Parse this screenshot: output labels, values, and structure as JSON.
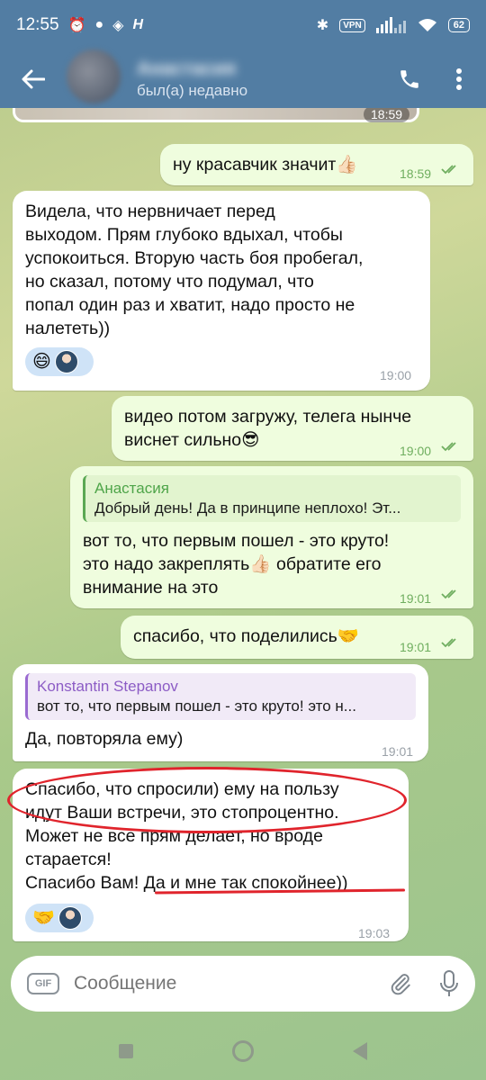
{
  "status_bar": {
    "time": "12:55",
    "vpn": "VPN",
    "battery": "62"
  },
  "header": {
    "contact_name": "Анастасия",
    "contact_status": "был(а) недавно"
  },
  "photo_time": "18:59",
  "messages": [
    {
      "id": "m1",
      "side": "out",
      "text": "ну красавчик значит👍🏻",
      "time": "18:59"
    },
    {
      "id": "m2",
      "side": "in",
      "lines": [
        "Видела, что нервничает перед",
        "выходом. Прям глубоко вдыхал, чтобы",
        "успокоиться. Вторую часть боя пробегал,",
        "но сказал, потому что подумал, что",
        "попал один раз и хватит, надо просто не",
        "налететь))"
      ],
      "time": "19:00",
      "reaction": "😄"
    },
    {
      "id": "m3",
      "side": "out",
      "lines": [
        "видео потом загружу, телега нынче",
        "виснет сильно😎"
      ],
      "time": "19:00"
    },
    {
      "id": "m4",
      "side": "out",
      "reply_name": "Анастасия",
      "reply_text": "Добрый день! Да в принципе неплохо! Эт...",
      "lines": [
        "вот то, что первым пошел - это круто!",
        "это надо закреплять👍🏻 обратите его",
        "внимание на это"
      ],
      "time": "19:01"
    },
    {
      "id": "m5",
      "side": "out",
      "text": "спасибо, что поделились🤝",
      "time": "19:01"
    },
    {
      "id": "m6",
      "side": "in",
      "reply_name": "Konstantin Stepanov",
      "reply_text": "вот то, что первым пошел - это круто! это н...",
      "text": "Да, повторяла ему)",
      "time": "19:01"
    },
    {
      "id": "m7",
      "side": "in",
      "lines": [
        "Спасибо, что спросили) ему на пользу",
        "идут Ваши встречи, это стопроцентно.",
        "Может не все прям делает, но вроде",
        "старается!",
        "Спасибо Вам! Да и мне так спокойнее))"
      ],
      "time": "19:03",
      "reaction": "🤝"
    }
  ],
  "input": {
    "gif_label": "GIF",
    "placeholder": "Сообщение"
  },
  "colors": {
    "header": "#527da3",
    "bubble_out": "#effdde",
    "bubble_in": "#ffffff",
    "annotation": "#e0242c"
  }
}
